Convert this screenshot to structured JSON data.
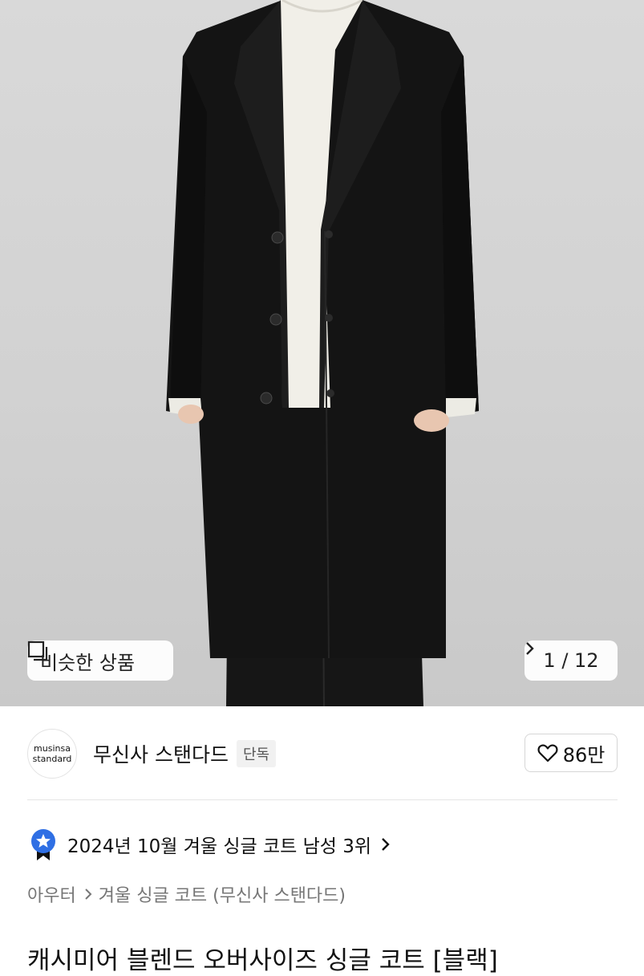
{
  "gallery": {
    "similar_label": "비슷한 상품",
    "counter": "1 / 12"
  },
  "brand": {
    "logo_line1": "musinsa",
    "logo_line2": "standard",
    "name": "무신사 스탠다드",
    "badge": "단독",
    "likes": "86만"
  },
  "ranking": {
    "text": "2024년 10월 겨울 싱글 코트 남성 3위"
  },
  "breadcrumb": {
    "category": "아우터",
    "subcategory": "겨울 싱글 코트 (무신사 스탠다드)"
  },
  "product": {
    "title": "캐시미어 블렌드 오버사이즈 싱글 코트 [블랙]"
  },
  "colors": {
    "accent": "#2f6fe4",
    "coat": "#111111",
    "sweater": "#f1efe8"
  }
}
